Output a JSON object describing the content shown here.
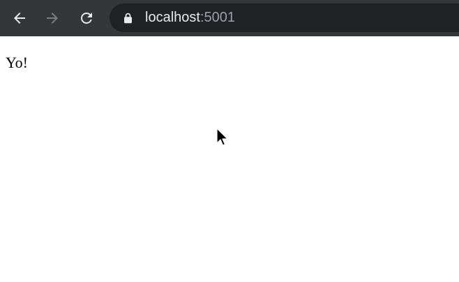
{
  "browser": {
    "address_bar": {
      "host": "localhost",
      "port": ":5001",
      "secure_icon": "lock-icon"
    },
    "nav": {
      "back_icon": "arrow-left-icon",
      "forward_icon": "arrow-right-icon",
      "forward_enabled": false,
      "reload_icon": "reload-icon"
    },
    "colors": {
      "toolbar_bg": "#35363a",
      "omnibox_bg": "#202124",
      "url_host": "#e8eaed",
      "url_port": "#9aa0a6"
    }
  },
  "page": {
    "text": "Yo!"
  }
}
